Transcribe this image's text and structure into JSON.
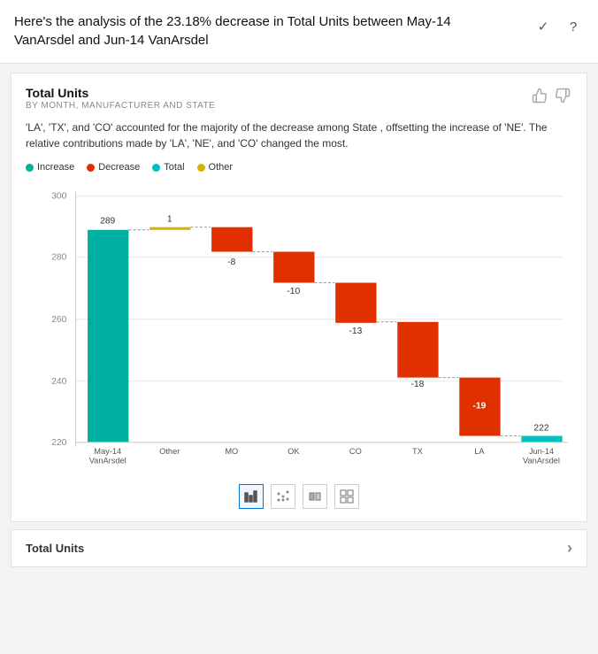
{
  "header": {
    "title": "Here's the analysis of the 23.18% decrease in Total Units between May-14 VanArsdel and Jun-14 VanArsdel",
    "check_icon": "✓",
    "help_icon": "?"
  },
  "card": {
    "title": "Total Units",
    "subtitle": "BY MONTH, MANUFACTURER AND STATE",
    "description": "'LA', 'TX', and 'CO' accounted for the majority of the decrease among State , offsetting the increase of 'NE'. The relative contributions made by 'LA', 'NE', and 'CO' changed the most.",
    "thumbup_icon": "👍",
    "thumbdown_icon": "👎"
  },
  "legend": {
    "items": [
      {
        "label": "Increase",
        "color": "#00b0a0"
      },
      {
        "label": "Decrease",
        "color": "#e03000"
      },
      {
        "label": "Total",
        "color": "#00c0c0"
      },
      {
        "label": "Other",
        "color": "#d4b400"
      }
    ]
  },
  "chart": {
    "y_axis_labels": [
      "220",
      "240",
      "260",
      "280",
      "300"
    ],
    "bars": [
      {
        "label": "May-14\nVanArsdel",
        "value": 289,
        "label_above": "289",
        "type": "total",
        "color": "#00b0a0"
      },
      {
        "label": "Other",
        "value": 1,
        "label_above": "1",
        "type": "other",
        "color": "#d4b400"
      },
      {
        "label": "MO",
        "value": -8,
        "label_above": "-8",
        "type": "decrease",
        "color": "#e03000"
      },
      {
        "label": "OK",
        "value": -10,
        "label_above": "-10",
        "type": "decrease",
        "color": "#e03000"
      },
      {
        "label": "CO",
        "value": -13,
        "label_above": "-13",
        "type": "decrease",
        "color": "#e03000"
      },
      {
        "label": "TX",
        "value": -18,
        "label_above": "-18",
        "type": "decrease",
        "color": "#e03000"
      },
      {
        "label": "LA",
        "value": -19,
        "label_above": "-19",
        "type": "decrease",
        "color": "#e03000"
      },
      {
        "label": "Jun-14\nVanArsdel",
        "value": 222,
        "label_above": "222",
        "type": "total",
        "color": "#00c0c0"
      }
    ],
    "reference_line": 289
  },
  "toolbar": {
    "icons": [
      "▦",
      "⠿",
      "▐▌",
      "⊞"
    ]
  },
  "bottom_card": {
    "title": "Total Units",
    "chevron_icon": "›"
  },
  "colors": {
    "increase": "#00b0a0",
    "decrease": "#e03000",
    "total_start": "#00b0a0",
    "total_end": "#00c0c0",
    "other": "#d4b400",
    "axis": "#888888",
    "grid": "#e8e8e8"
  }
}
